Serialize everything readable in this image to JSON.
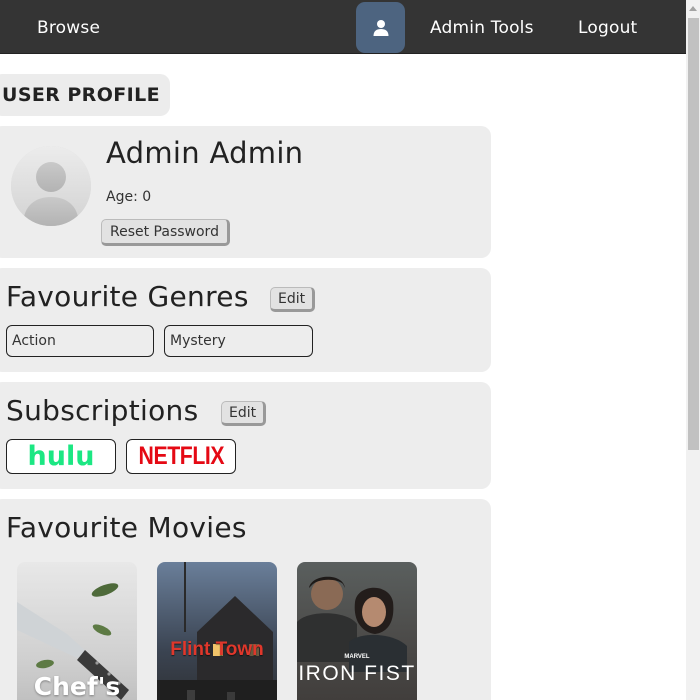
{
  "nav": {
    "browse": "Browse",
    "profile_icon": "user-icon",
    "admin_tools": "Admin Tools",
    "logout": "Logout"
  },
  "page": {
    "title": "USER PROFILE"
  },
  "profile": {
    "avatar_icon": "avatar-placeholder-icon",
    "name": "Admin Admin",
    "age": "Age: 0",
    "reset_password": "Reset Password"
  },
  "genres": {
    "title": "Favourite Genres",
    "edit": "Edit",
    "items": [
      "Action",
      "Mystery"
    ]
  },
  "subscriptions": {
    "title": "Subscriptions",
    "edit": "Edit",
    "items": [
      "hulu",
      "NETFLIX"
    ]
  },
  "movies": {
    "title": "Favourite Movies",
    "items": [
      {
        "title": "Chef's"
      },
      {
        "title": "Flint Town"
      },
      {
        "title": "IRON FIST",
        "brand": "MARVEL"
      }
    ]
  },
  "colors": {
    "navbar": "#343434",
    "profile_button": "#4d6480",
    "card": "#ededed",
    "hulu": "#1ce783",
    "netflix": "#e50914"
  }
}
